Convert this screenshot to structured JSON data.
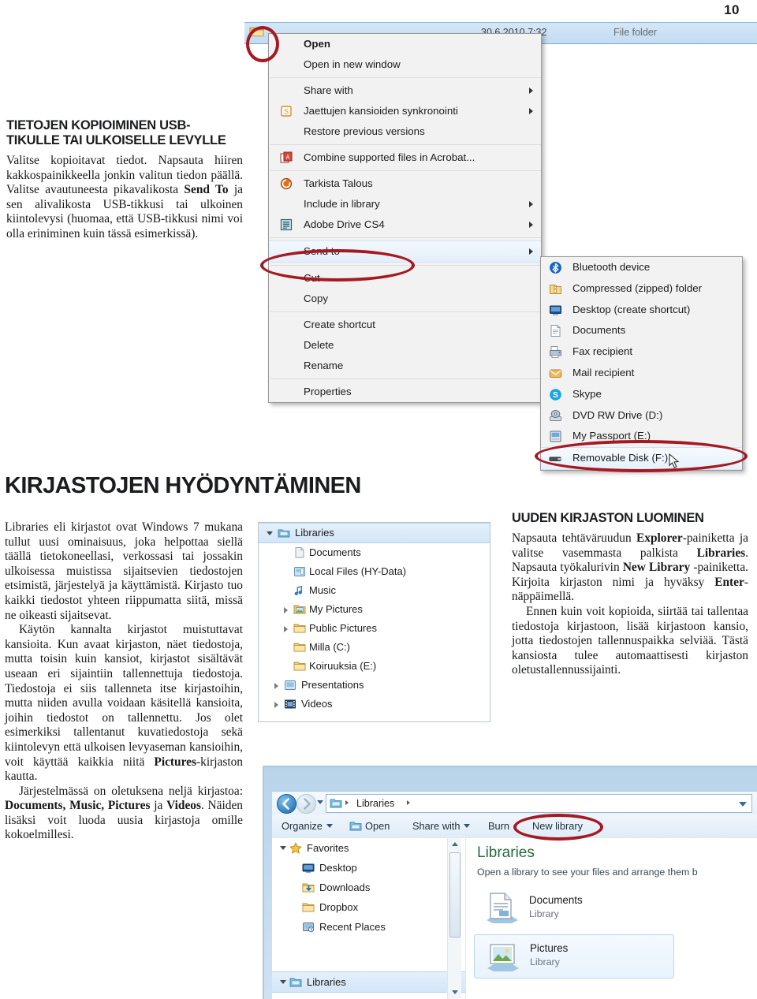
{
  "page": {
    "number": "10"
  },
  "article_usb": {
    "heading": "TIETOJEN KOPIOIMINEN USB-TIKULLE TAI ULKOISELLE LEVYLLE",
    "paragraph_1_a": "Valitse kopioitavat tiedot. Napsauta hiiren kakkospainikkeella jonkin valitun tiedon päällä. Valitse avautuneesta pikavalikosta ",
    "paragraph_1_bold": "Send To",
    "paragraph_1_b": " ja sen alivalikosta USB-tikkusi tai ulkoinen kiintolevysi (huomaa, että USB-tikkusi nimi voi olla eriniminen kuin tässä esimerkissä)."
  },
  "main_heading": "KIRJASTOJEN HYÖDYNTÄMINEN",
  "article_libraries": {
    "paragraph_1": "Libraries eli kirjastot ovat Windows 7 mukana tullut uusi ominaisuus, joka helpottaa siellä täällä tietokoneellasi, verkossasi tai jossakin ulkoisessa muistissa sijaitsevien tiedostojen etsimistä, järjestelyä ja käyttämistä. Kirjasto tuo kaikki tiedostot yhteen riippumatta siitä, missä ne oikeasti sijaitsevat.",
    "paragraph_2": "Käytön kannalta kirjastot muistuttavat kansioita. Kun avaat kirjaston, näet tiedostoja, mutta toisin kuin kansiot, kirjastot sisältävät useaan eri sijaintiin tallennettuja tiedostoja. Tiedostoja ei siis tallenneta itse kirjastoihin, mutta niiden avulla voidaan käsitellä kansioita, joihin tiedostot on tallennettu. Jos olet esimerkiksi tallentanut kuvatiedostoja sekä kiintolevyn että ulkoisen levyaseman kansioihin, voit käyttää kaikkia niitä ",
    "paragraph_2_bold": "Pictures",
    "paragraph_2_tail": "-kirjaston kautta.",
    "paragraph_3_a": "Järjestelmässä on oletuksena neljä kirjastoa: ",
    "paragraph_3_b1": "Documents, Music, Pictures",
    "paragraph_3_c": " ja ",
    "paragraph_3_b2": "Videos",
    "paragraph_3_d": ". Näiden lisäksi voit luoda uusia kirjastoja omille kokoelmillesi."
  },
  "article_newlibrary": {
    "heading": "UUDEN KIRJASTON LUOMINEN",
    "p1_a": "Napsauta tehtäväruudun ",
    "p1_b1": "Explorer",
    "p1_b": "-painiketta ja valitse vasemmasta palkista ",
    "p1_b2": "Libraries",
    "p1_c": ". Napsauta työkalurivin ",
    "p1_b3": "New Library",
    "p1_d": " -painiketta. Kirjoita kirjaston nimi ja hyväksy ",
    "p1_b4": "Enter",
    "p1_e": "-näppäimellä.",
    "p2": "Ennen kuin voit kopioida, siirtää tai tallentaa tiedostoja kirjastoon, lisää kirjastoon kansio, jotta tiedostojen tallennuspaikka selviää. Tästä kansiosta tulee automaattisesti kirjaston oletustallennussijainti."
  },
  "screenshot_context_menu": {
    "detail_row": {
      "date": "30.6.2010 7:32",
      "type": "File folder"
    },
    "items": [
      {
        "label": "Open",
        "bold": true,
        "icon": null,
        "arrow": false
      },
      {
        "label": "Open in new window",
        "bold": false,
        "icon": null,
        "arrow": false
      },
      {
        "separator": true
      },
      {
        "label": "Share with",
        "bold": false,
        "icon": null,
        "arrow": true
      },
      {
        "label": "Jaettujen kansioiden synkronointi",
        "bold": false,
        "icon": "sync-icon",
        "arrow": true
      },
      {
        "label": "Restore previous versions",
        "bold": false,
        "icon": null,
        "arrow": false
      },
      {
        "separator": true
      },
      {
        "label": "Combine supported files in Acrobat...",
        "bold": false,
        "icon": "acrobat-icon",
        "arrow": false
      },
      {
        "separator": true
      },
      {
        "label": "Tarkista Talous",
        "bold": false,
        "icon": "antivirus-icon",
        "arrow": false
      },
      {
        "label": "Include in library",
        "bold": false,
        "icon": null,
        "arrow": true
      },
      {
        "label": "Adobe Drive CS4",
        "bold": false,
        "icon": "adobe-drive-icon",
        "arrow": true
      },
      {
        "separator": true
      },
      {
        "label": "Send to",
        "bold": false,
        "icon": null,
        "arrow": true,
        "selected": true
      },
      {
        "separator": true
      },
      {
        "label": "Cut",
        "bold": false,
        "icon": null,
        "arrow": false
      },
      {
        "label": "Copy",
        "bold": false,
        "icon": null,
        "arrow": false
      },
      {
        "separator": true
      },
      {
        "label": "Create shortcut",
        "bold": false,
        "icon": null,
        "arrow": false
      },
      {
        "label": "Delete",
        "bold": false,
        "icon": null,
        "arrow": false
      },
      {
        "label": "Rename",
        "bold": false,
        "icon": null,
        "arrow": false
      },
      {
        "separator": true
      },
      {
        "label": "Properties",
        "bold": false,
        "icon": null,
        "arrow": false
      }
    ],
    "submenu": [
      {
        "label": "Bluetooth device",
        "icon": "bluetooth-icon"
      },
      {
        "label": "Compressed (zipped) folder",
        "icon": "zip-folder-icon"
      },
      {
        "label": "Desktop (create shortcut)",
        "icon": "desktop-icon"
      },
      {
        "label": "Documents",
        "icon": "documents-icon"
      },
      {
        "label": "Fax recipient",
        "icon": "fax-icon"
      },
      {
        "label": "Mail recipient",
        "icon": "mail-icon"
      },
      {
        "label": "Skype",
        "icon": "skype-icon"
      },
      {
        "label": "DVD RW Drive (D:)",
        "icon": "dvd-drive-icon"
      },
      {
        "label": "My Passport (E:)",
        "icon": "hard-drive-icon"
      },
      {
        "label": "Removable Disk (F:)",
        "icon": "usb-drive-icon",
        "selected": true
      }
    ]
  },
  "screenshot_tree": {
    "rows": [
      {
        "label": "Libraries",
        "depth": 0,
        "icon": "libraries-icon",
        "twisty": "open",
        "selected": true
      },
      {
        "label": "Documents",
        "depth": 1,
        "icon": "documents-icon",
        "twisty": "none"
      },
      {
        "label": "Local Files (HY-Data)",
        "depth": 1,
        "icon": "network-folder-icon",
        "twisty": "none"
      },
      {
        "label": "Music",
        "depth": 1,
        "icon": "music-icon",
        "twisty": "none"
      },
      {
        "label": "My Pictures",
        "depth": 1,
        "icon": "pictures-folder-icon",
        "twisty": "closed"
      },
      {
        "label": "Public Pictures",
        "depth": 1,
        "icon": "folder-icon",
        "twisty": "closed"
      },
      {
        "label": "Milla (C:)",
        "depth": 1,
        "icon": "folder-icon",
        "twisty": "none"
      },
      {
        "label": "Koiruuksia (E:)",
        "depth": 1,
        "icon": "folder-icon",
        "twisty": "none"
      },
      {
        "label": "Presentations",
        "depth": 0,
        "icon": "presentations-icon",
        "twisty": "closed"
      },
      {
        "label": "Videos",
        "depth": 0,
        "icon": "videos-icon",
        "twisty": "closed"
      }
    ]
  },
  "screenshot_explorer": {
    "address": {
      "crumb": "Libraries"
    },
    "toolbar": [
      {
        "label": "Organize",
        "caret": true,
        "icon": null
      },
      {
        "label": "Open",
        "caret": false,
        "icon": "open-folder-icon"
      },
      {
        "label": "Share with",
        "caret": true,
        "icon": null
      },
      {
        "label": "Burn",
        "caret": false,
        "icon": null
      },
      {
        "label": "New library",
        "caret": false,
        "icon": null,
        "highlighted": true
      }
    ],
    "nav_rows": [
      {
        "label": "Favorites",
        "depth": 0,
        "icon": "star-icon",
        "twisty": "open"
      },
      {
        "label": "Desktop",
        "depth": 1,
        "icon": "desktop-icon",
        "twisty": "none"
      },
      {
        "label": "Downloads",
        "depth": 1,
        "icon": "downloads-icon",
        "twisty": "none"
      },
      {
        "label": "Dropbox",
        "depth": 1,
        "icon": "folder-icon",
        "twisty": "none"
      },
      {
        "label": "Recent Places",
        "depth": 1,
        "icon": "recent-places-icon",
        "twisty": "none"
      },
      {
        "label": "Libraries",
        "depth": 0,
        "icon": "libraries-icon",
        "twisty": "open",
        "selected": true
      }
    ],
    "content": {
      "title": "Libraries",
      "subtitle": "Open a library to see your files and arrange them b",
      "tiles": [
        {
          "name": "Documents",
          "sub": "Library",
          "icon": "documents-library-icon",
          "selected": false
        },
        {
          "name": "Pictures",
          "sub": "Library",
          "icon": "pictures-library-icon",
          "selected": true
        }
      ]
    }
  },
  "colors": {
    "annotation_red": "#a51a22",
    "heading_black": "#1b1c1e",
    "library_green": "#2a6a3e",
    "selection_blue": "#cfe2f3"
  }
}
